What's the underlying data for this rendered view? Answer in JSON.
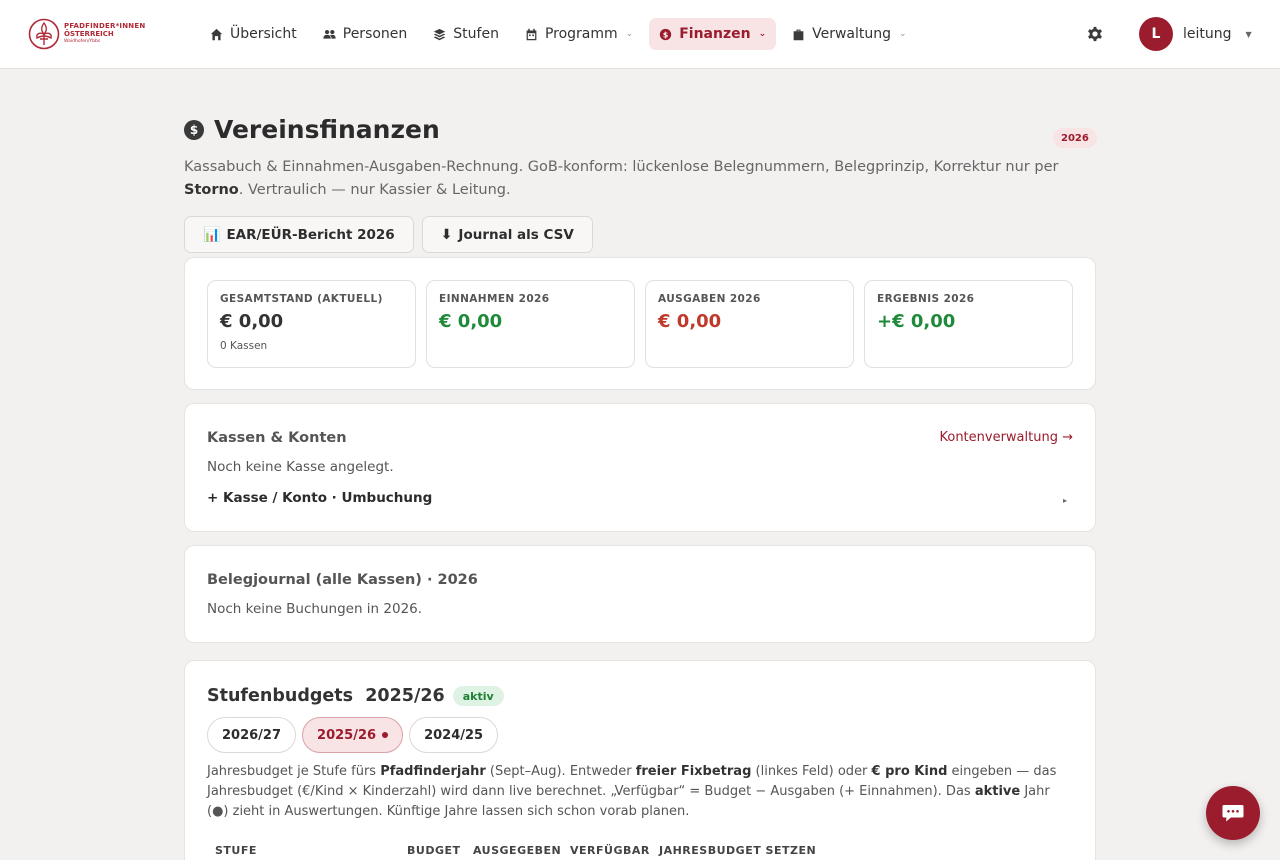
{
  "brand": {
    "line1": "PFADFINDER*INNEN",
    "line2": "ÖSTERREICH",
    "line3": "Waidhofen/Ybbs",
    "color": "#b02a37"
  },
  "nav": {
    "items": [
      {
        "label": "Übersicht",
        "icon": "home-icon"
      },
      {
        "label": "Personen",
        "icon": "users-icon"
      },
      {
        "label": "Stufen",
        "icon": "layers-icon"
      },
      {
        "label": "Programm",
        "icon": "calendar-icon",
        "dropdown": true
      },
      {
        "label": "Finanzen",
        "icon": "dollar-icon",
        "dropdown": true,
        "active": true
      },
      {
        "label": "Verwaltung",
        "icon": "briefcase-icon",
        "dropdown": true
      }
    ]
  },
  "user": {
    "initial": "L",
    "name": "leitung"
  },
  "page": {
    "title": "Vereinsfinanzen",
    "year": "2026",
    "lead_a": "Kassabuch & Einnahmen-Ausgaben-Rechnung. GoB-konform: lückenlose Belegnummern, Belegprinzip, Korrektur nur per ",
    "lead_b": "Storno",
    "lead_c": ". Vertraulich — nur Kassier & Leitung."
  },
  "actions": {
    "report": "EAR/EÜR-Bericht 2026",
    "csv": "Journal als CSV"
  },
  "stats": [
    {
      "label": "GESAMTSTAND (AKTUELL)",
      "value": "€ 0,00",
      "sub": "0 Kassen",
      "tone": "neutral"
    },
    {
      "label": "EINNAHMEN 2026",
      "value": "€ 0,00",
      "tone": "green"
    },
    {
      "label": "AUSGABEN 2026",
      "value": "€ 0,00",
      "tone": "red"
    },
    {
      "label": "ERGEBNIS 2026",
      "value": "+€ 0,00",
      "tone": "green"
    }
  ],
  "kassen": {
    "title": "Kassen & Konten",
    "link": "Kontenverwaltung →",
    "empty": "Noch keine Kasse angelegt.",
    "summary": "+ Kasse / Konto · Umbuchung"
  },
  "journal": {
    "title": "Belegjournal (alle Kassen) · 2026",
    "empty": "Noch keine Buchungen in 2026."
  },
  "budgets": {
    "title": "Stufenbudgets  2025/26",
    "badge": "aktiv",
    "years": [
      {
        "label": "2026/27",
        "selected": false
      },
      {
        "label": "2025/26",
        "selected": true
      },
      {
        "label": "2024/25",
        "selected": false
      }
    ],
    "desc": [
      {
        "t": "Jahresbudget je Stufe fürs "
      },
      {
        "t": "Pfadfinderjahr",
        "b": true
      },
      {
        "t": " (Sept–Aug). Entweder "
      },
      {
        "t": "freier Fixbetrag",
        "b": true
      },
      {
        "t": " (linkes Feld) oder "
      },
      {
        "t": "€ pro Kind",
        "b": true
      },
      {
        "t": " eingeben — das Jahresbudget (€/Kind × Kinderzahl) wird dann live berechnet. „Verfügbar“ = Budget − Ausgaben (+ Einnahmen). Das "
      },
      {
        "t": "aktive",
        "b": true
      },
      {
        "t": " Jahr (●) zieht in Auswertungen. Künftige Jahre lassen sich schon vorab planen."
      }
    ],
    "columns": [
      "STUFE",
      "BUDGET",
      "AUSGEGEBEN",
      "VERFÜGBAR",
      "JAHRESBUDGET SETZEN"
    ]
  },
  "colors": {
    "accent": "#9b1c2c",
    "green": "#1e8a3a",
    "red": "#c0392b"
  }
}
